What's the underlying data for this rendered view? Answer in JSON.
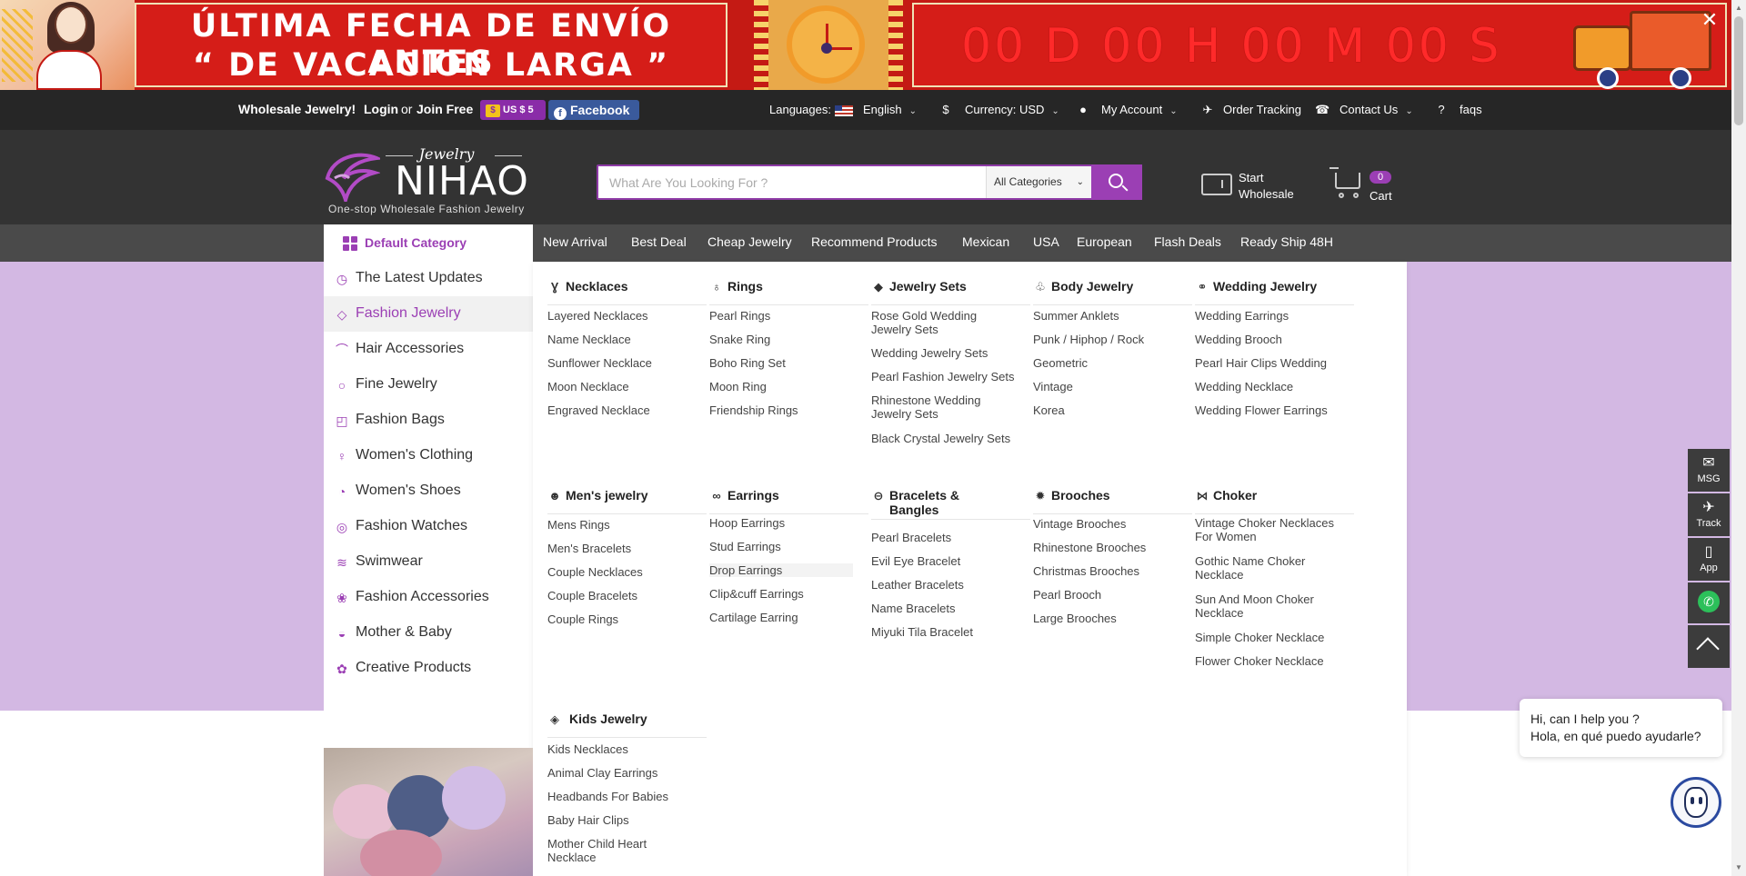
{
  "banner": {
    "line1": "ÚLTIMA FECHA DE ENVÍO ANTES",
    "line2": "“ DE VACACION LARGA ”",
    "countdown": "00 D 00 H 00 M 00 S",
    "close_glyph": "✕"
  },
  "topbar": {
    "wholesale": "Wholesale Jewelry!",
    "login": "Login",
    "or": "or",
    "join": "Join Free",
    "coupon": "US $ 5",
    "facebook": "Facebook",
    "languages_label": "Languages:",
    "language": "English",
    "currency": "Currency: USD",
    "account": "My Account",
    "tracking": "Order Tracking",
    "contact": "Contact Us",
    "faqs": "faqs"
  },
  "header": {
    "logo_script": "Jewelry",
    "logo_name": "NIHAO",
    "logo_tagline": "One-stop Wholesale Fashion Jewelry",
    "search_placeholder": "What Are You Looking For ?",
    "search_category": "All Categories",
    "start_wholesale": "Start\nWholesale",
    "cart_count": "0",
    "cart_label": "Cart"
  },
  "nav": {
    "default_category": "Default Category",
    "items": [
      "New Arrival",
      "Best Deal",
      "Cheap Jewelry",
      "Recommend Products",
      "Mexican",
      "USA",
      "European",
      "Flash Deals",
      "Ready Ship 48H"
    ]
  },
  "sidebar": {
    "items": [
      {
        "label": "The Latest Updates",
        "icon": "update-icon"
      },
      {
        "label": "Fashion Jewelry",
        "icon": "diamond-icon",
        "active": true
      },
      {
        "label": "Hair Accessories",
        "icon": "hairband-icon"
      },
      {
        "label": "Fine Jewelry",
        "icon": "ring-icon"
      },
      {
        "label": "Fashion Bags",
        "icon": "bag-icon"
      },
      {
        "label": "Women's Clothing",
        "icon": "dress-icon"
      },
      {
        "label": "Women's Shoes",
        "icon": "shoe-icon"
      },
      {
        "label": "Fashion Watches",
        "icon": "watch-icon"
      },
      {
        "label": "Swimwear",
        "icon": "swimwear-icon"
      },
      {
        "label": "Fashion Accessories",
        "icon": "accessory-icon"
      },
      {
        "label": "Mother & Baby",
        "icon": "stroller-icon"
      },
      {
        "label": "Creative Products",
        "icon": "gift-icon"
      }
    ]
  },
  "mega": {
    "columns": [
      {
        "title": "Necklaces",
        "icon": "necklace-icon",
        "links": [
          "Layered Necklaces",
          "Name Necklace",
          "Sunflower Necklace",
          "Moon Necklace",
          "Engraved Necklace"
        ]
      },
      {
        "title": "Rings",
        "icon": "ring-icon",
        "links": [
          "Pearl Rings",
          "Snake Ring",
          "Boho Ring Set",
          "Moon Ring",
          "Friendship Rings"
        ]
      },
      {
        "title": "Jewelry Sets",
        "icon": "gem-icon",
        "links": [
          "Rose Gold Wedding Jewelry Sets",
          "Wedding Jewelry Sets",
          "Pearl Fashion Jewelry Sets",
          "Rhinestone Wedding Jewelry Sets",
          "Black Crystal Jewelry Sets"
        ]
      },
      {
        "title": "Body Jewelry",
        "icon": "body-jewelry-icon",
        "links": [
          "Summer Anklets",
          "Punk / Hiphop / Rock",
          "Geometric",
          "Vintage",
          "Korea"
        ]
      },
      {
        "title": "Wedding Jewelry",
        "icon": "wedding-icon",
        "links": [
          "Wedding Earrings",
          "Wedding Brooch",
          "Pearl Hair Clips Wedding",
          "Wedding Necklace",
          "Wedding Flower Earrings"
        ]
      },
      {
        "title": "Men's jewelry",
        "icon": "man-icon",
        "links": [
          "Mens Rings",
          "Men's Bracelets",
          "Couple Necklaces",
          "Couple Bracelets",
          "Couple Rings"
        ]
      },
      {
        "title": "Earrings",
        "icon": "earrings-icon",
        "links": [
          "Hoop Earrings",
          "Stud Earrings",
          "Drop Earrings",
          "Clip&cuff Earrings",
          "Cartilage Earring"
        ]
      },
      {
        "title": "Bracelets & Bangles",
        "icon": "bracelet-icon",
        "links": [
          "Pearl Bracelets",
          "Evil Eye Bracelet",
          "Leather Bracelets",
          "Name Bracelets",
          "Miyuki Tila Bracelet"
        ]
      },
      {
        "title": "Brooches",
        "icon": "brooch-icon",
        "links": [
          "Vintage Brooches",
          "Rhinestone Brooches",
          "Christmas Brooches",
          "Pearl Brooch",
          "Large Brooches"
        ]
      },
      {
        "title": "Choker",
        "icon": "choker-icon",
        "links": [
          "Vintage Choker Necklaces For Women",
          "Gothic Name Choker Necklace",
          "Sun And Moon Choker Necklace",
          "Simple Choker Necklace",
          "Flower Choker Necklace"
        ]
      },
      {
        "title": "Kids Jewelry",
        "icon": "kids-icon",
        "links": [
          "Kids Necklaces",
          "Animal Clay Earrings",
          "Headbands For Babies",
          "Baby Hair Clips",
          "Mother Child Heart Necklace"
        ]
      }
    ]
  },
  "float": {
    "msg": "MSG",
    "track": "Track",
    "app": "App"
  },
  "chat": {
    "line1": "Hi, can I help you ?",
    "line2": "Hola, en qué puedo ayudarle?"
  },
  "colors": {
    "brand_purple": "#9b3fb4",
    "banner_red": "#c41a14",
    "page_purple": "#d3b8e3",
    "header_dark": "#333333"
  }
}
